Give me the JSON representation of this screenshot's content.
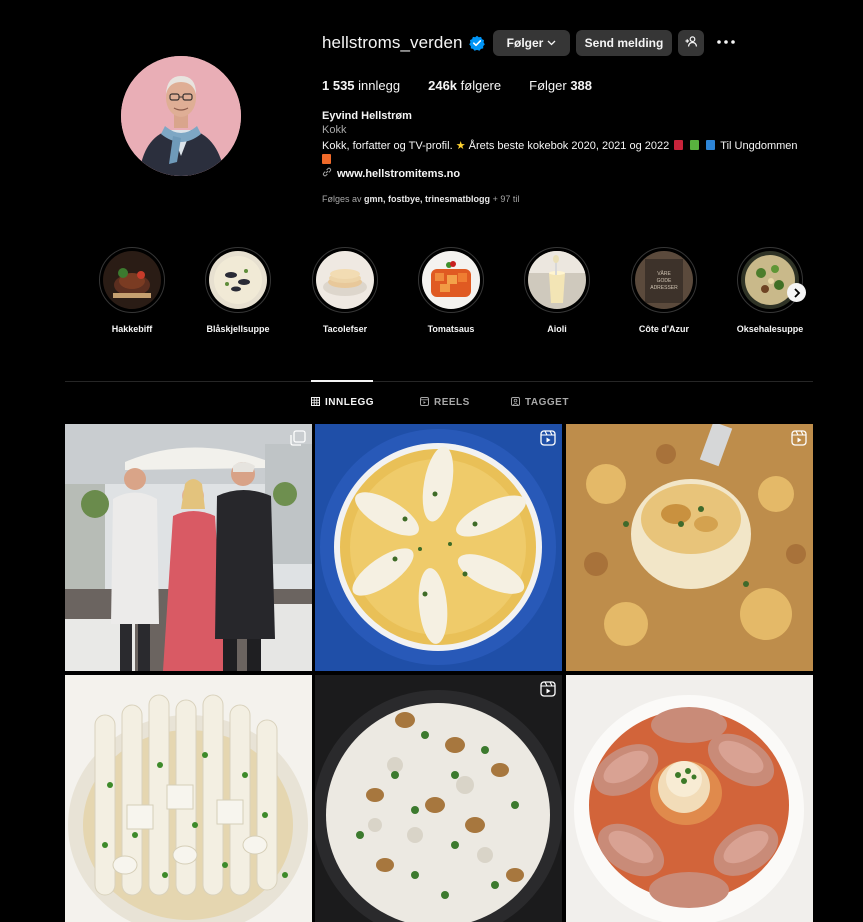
{
  "profile": {
    "username": "hellstroms_verden",
    "verified_icon": "verified-badge-icon",
    "buttons": {
      "follow": "Følger",
      "message": "Send melding",
      "suggest_icon": "+person-icon",
      "more_icon": "more-dots-icon"
    },
    "stats": {
      "posts_count": "1 535",
      "posts_label": "innlegg",
      "followers_count": "246k",
      "followers_label": "følgere",
      "following_label": "Følger",
      "following_count": "388"
    },
    "full_name": "Eyvind Hellstrøm",
    "category": "Kokk",
    "bio_text": "Kokk, forfatter og TV-profil.",
    "bio_award": "Årets beste kokebok 2020, 2021 og 2022",
    "bio_tail": "Til Ungdommen",
    "website": "www.hellstromitems.no",
    "followed_by_prefix": "Følges av",
    "followed_by_names": "gmn, fostbye, trinesmatblogg",
    "followed_by_more": "+ 97 til"
  },
  "highlights": [
    {
      "label": "Hakkebiff"
    },
    {
      "label": "Blåskjellsuppe"
    },
    {
      "label": "Tacolefser"
    },
    {
      "label": "Tomatsaus"
    },
    {
      "label": "Aioli"
    },
    {
      "label": "Côte d'Azur"
    },
    {
      "label": "Oksehalesuppe"
    }
  ],
  "highlight_6_text": "VÅRE GODE ADRESSER",
  "tabs": [
    {
      "label": "INNLEGG",
      "icon": "grid-icon",
      "active": true
    },
    {
      "label": "REELS",
      "icon": "reels-icon",
      "active": false
    },
    {
      "label": "TAGGET",
      "icon": "tagged-icon",
      "active": false
    }
  ],
  "posts": [
    {
      "type": "carousel"
    },
    {
      "type": "reel"
    },
    {
      "type": "reel"
    },
    {
      "type": "image"
    },
    {
      "type": "reel"
    },
    {
      "type": "image"
    }
  ],
  "colors": {
    "background": "#000000",
    "button_bg": "#363636",
    "verified": "#0095f6",
    "muted_text": "#a8a8a8"
  }
}
